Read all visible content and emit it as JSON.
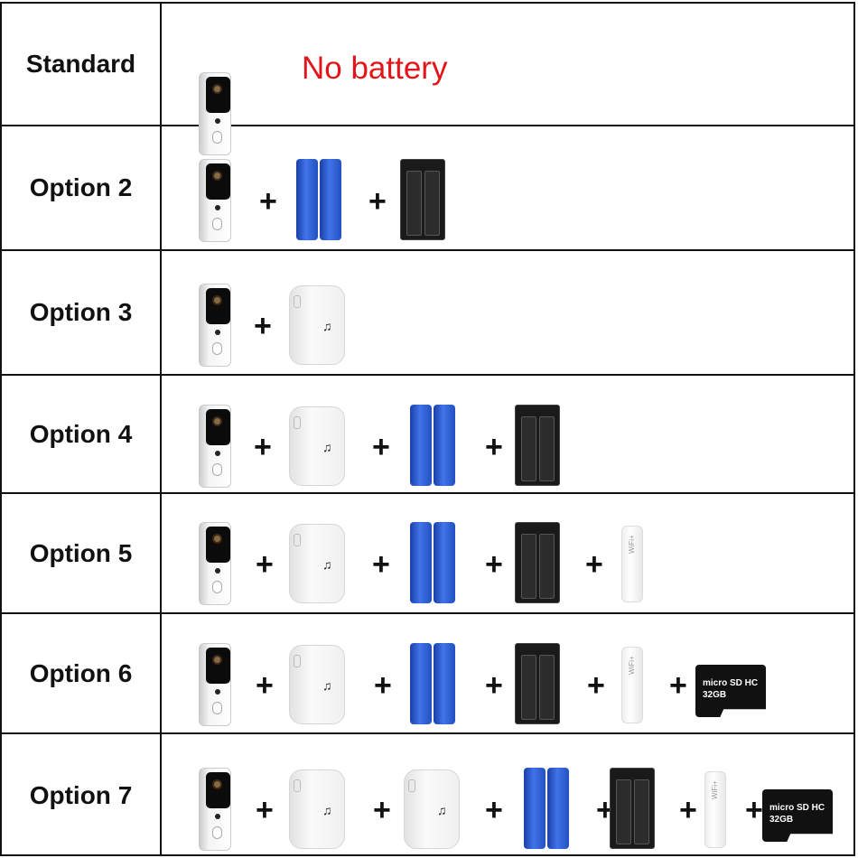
{
  "rows": [
    {
      "label": "Standard",
      "note": "No battery",
      "items": [
        "doorbell"
      ]
    },
    {
      "label": "Option 2",
      "items": [
        "doorbell",
        "batteries",
        "charger"
      ]
    },
    {
      "label": "Option 3",
      "items": [
        "doorbell",
        "chime"
      ]
    },
    {
      "label": "Option 4",
      "items": [
        "doorbell",
        "chime",
        "batteries",
        "charger"
      ]
    },
    {
      "label": "Option 5",
      "items": [
        "doorbell",
        "chime",
        "batteries",
        "charger",
        "wifi-extender"
      ]
    },
    {
      "label": "Option 6",
      "items": [
        "doorbell",
        "chime",
        "batteries",
        "charger",
        "wifi-extender",
        "sd-card"
      ]
    },
    {
      "label": "Option 7",
      "items": [
        "doorbell",
        "chime",
        "chime",
        "batteries",
        "charger",
        "wifi-extender",
        "sd-card"
      ]
    }
  ],
  "plus": "+",
  "chime_icon": "music-note-icon",
  "wifi_text": "WiFi+",
  "sd_text": "micro SD HC 32GB",
  "colors": {
    "note": "#e4141b",
    "battery": "#2f5fd6",
    "border": "#111111"
  }
}
